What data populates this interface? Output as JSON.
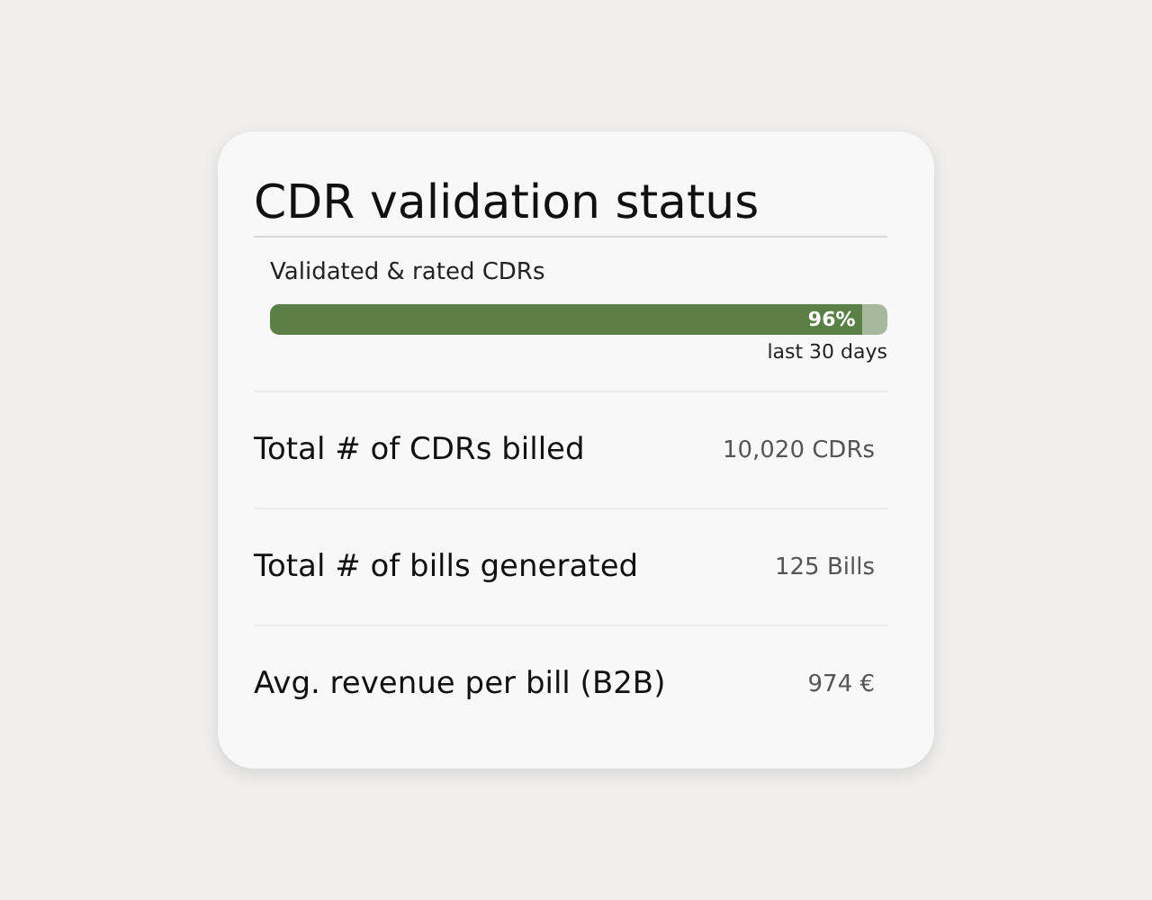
{
  "card": {
    "title": "CDR validation status",
    "progress": {
      "label": "Validated & rated CDRs",
      "level": 0.96,
      "reading": "96%",
      "period": "last 30 days"
    },
    "stats": [
      {
        "label": "Total # of CDRs billed",
        "value": "10,020 CDRs"
      },
      {
        "label": "Total # of bills generated",
        "value": "125 Bills"
      },
      {
        "label": "Avg. revenue per bill (B2B)",
        "value": "974 €"
      }
    ]
  }
}
